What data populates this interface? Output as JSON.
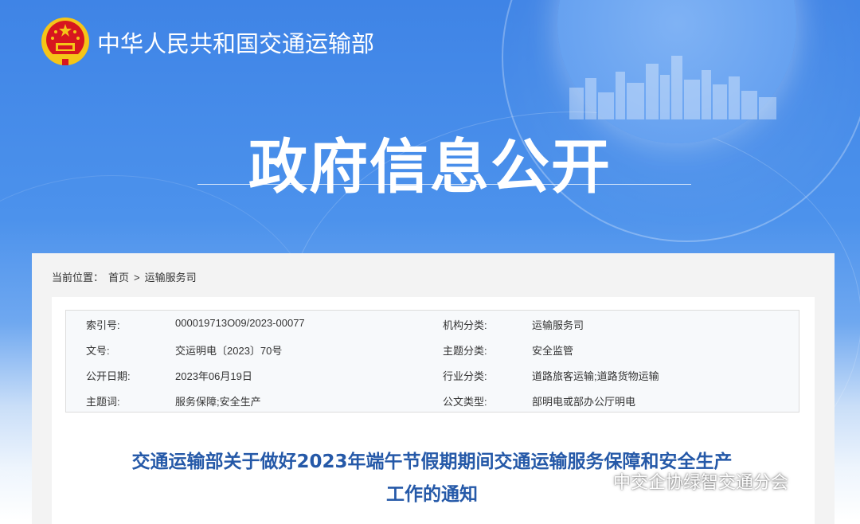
{
  "header": {
    "ministry_name": "中华人民共和国交通运输部",
    "banner_title": "政府信息公开"
  },
  "breadcrumb": {
    "label": "当前位置：",
    "home": "首页",
    "separator": ">",
    "current": "运输服务司"
  },
  "metadata": {
    "rows": [
      {
        "k1": "索引号:",
        "v1": "000019713O09/2023-00077",
        "k2": "机构分类:",
        "v2": "运输服务司"
      },
      {
        "k1": "文号:",
        "v1": "交运明电〔2023〕70号",
        "k2": "主题分类:",
        "v2": "安全监管"
      },
      {
        "k1": "公开日期:",
        "v1": "2023年06月19日",
        "k2": "行业分类:",
        "v2": "道路旅客运输;道路货物运输"
      },
      {
        "k1": "主题词:",
        "v1": "服务保障;安全生产",
        "k2": "公文类型:",
        "v2": "部明电或部办公厅明电"
      }
    ]
  },
  "document": {
    "title_line1": "交通运输部关于做好2023年端午节假期期间交通运输服务保障和安全生产",
    "title_line2": "工作的通知"
  },
  "watermark": {
    "text": "中交企协绿智交通分会",
    "icon": "wechat-icon"
  },
  "colors": {
    "banner_blue": "#4c92ec",
    "title_blue": "#2559a8",
    "emblem_red": "#d7161f",
    "emblem_gold": "#f5c518"
  }
}
